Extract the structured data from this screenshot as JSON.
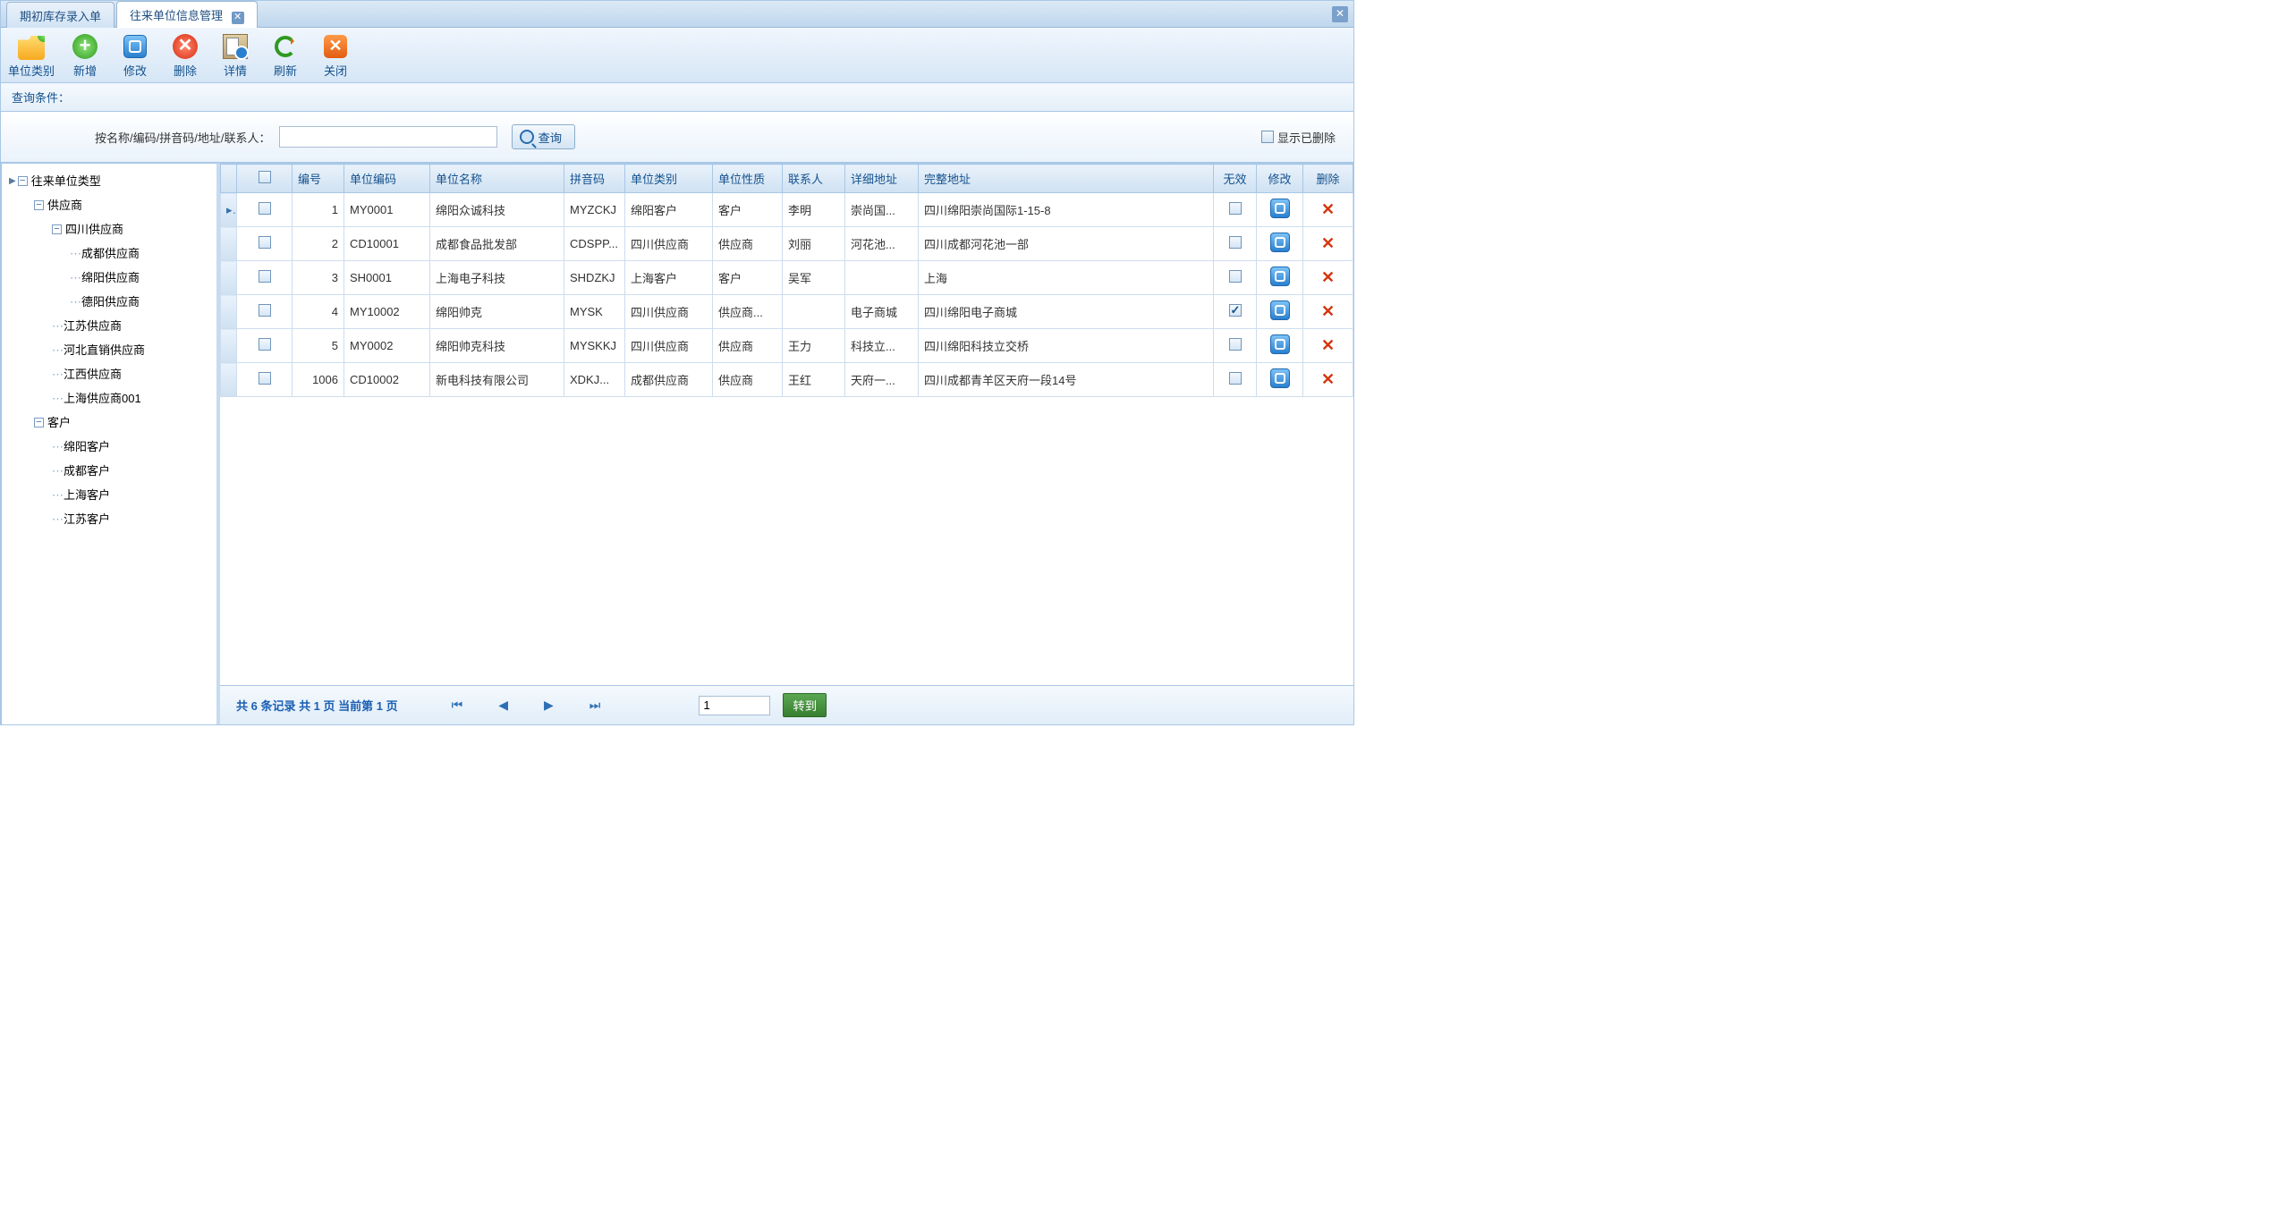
{
  "tabs": {
    "inactive": "期初库存录入单",
    "active": "往来单位信息管理"
  },
  "toolbar": {
    "category": "单位类别",
    "add": "新增",
    "edit": "修改",
    "delete": "删除",
    "detail": "详情",
    "refresh": "刷新",
    "close": "关闭"
  },
  "query": {
    "title": "查询条件：",
    "label": "按名称/编码/拼音码/地址/联系人：",
    "value": "",
    "button": "查询",
    "show_deleted": "显示已删除"
  },
  "tree": {
    "root": "往来单位类型",
    "supplier": "供应商",
    "sichuan_supplier": "四川供应商",
    "chengdu_supplier": "成都供应商",
    "mianyang_supplier": "绵阳供应商",
    "deyang_supplier": "德阳供应商",
    "jiangsu_supplier": "江苏供应商",
    "hebei_supplier": "河北直销供应商",
    "jiangxi_supplier": "江西供应商",
    "shanghai_supplier": "上海供应商001",
    "customer": "客户",
    "mianyang_customer": "绵阳客户",
    "chengdu_customer": "成都客户",
    "shanghai_customer": "上海客户",
    "jiangsu_customer": "江苏客户"
  },
  "columns": {
    "no": "编号",
    "code": "单位编码",
    "name": "单位名称",
    "pinyin": "拼音码",
    "category": "单位类别",
    "nature": "单位性质",
    "contact": "联系人",
    "detail_addr": "详细地址",
    "full_addr": "完整地址",
    "invalid": "无效",
    "edit": "修改",
    "delete": "删除"
  },
  "rows": [
    {
      "no": "1",
      "code": "MY0001",
      "name": "绵阳众诚科技",
      "pinyin": "MYZCKJ",
      "category": "绵阳客户",
      "nature": "客户",
      "contact": "李明",
      "detail": "崇尚国...",
      "full": "四川绵阳崇尚国际1-15-8",
      "invalid": false
    },
    {
      "no": "2",
      "code": "CD10001",
      "name": "成都食品批发部",
      "pinyin": "CDSPP...",
      "category": "四川供应商",
      "nature": "供应商",
      "contact": "刘丽",
      "detail": "河花池...",
      "full": "四川成都河花池一部",
      "invalid": false
    },
    {
      "no": "3",
      "code": "SH0001",
      "name": "上海电子科技",
      "pinyin": "SHDZKJ",
      "category": "上海客户",
      "nature": "客户",
      "contact": "吴军",
      "detail": "",
      "full": "上海",
      "invalid": false
    },
    {
      "no": "4",
      "code": "MY10002",
      "name": "绵阳帅克",
      "pinyin": "MYSK",
      "category": "四川供应商",
      "nature": "供应商...",
      "contact": "",
      "detail": "电子商城",
      "full": "四川绵阳电子商城",
      "invalid": true
    },
    {
      "no": "5",
      "code": "MY0002",
      "name": "绵阳帅克科技",
      "pinyin": "MYSKKJ",
      "category": "四川供应商",
      "nature": "供应商",
      "contact": "王力",
      "detail": "科技立...",
      "full": "四川绵阳科技立交桥",
      "invalid": false
    },
    {
      "no": "1006",
      "code": "CD10002",
      "name": "新电科技有限公司",
      "pinyin": "XDKJ...",
      "category": "成都供应商",
      "nature": "供应商",
      "contact": "王红",
      "detail": "天府一...",
      "full": "四川成都青羊区天府一段14号",
      "invalid": false
    }
  ],
  "pager": {
    "summary": "共 6 条记录  共 1 页  当前第 1 页",
    "page_input": "1",
    "go": "转到"
  }
}
